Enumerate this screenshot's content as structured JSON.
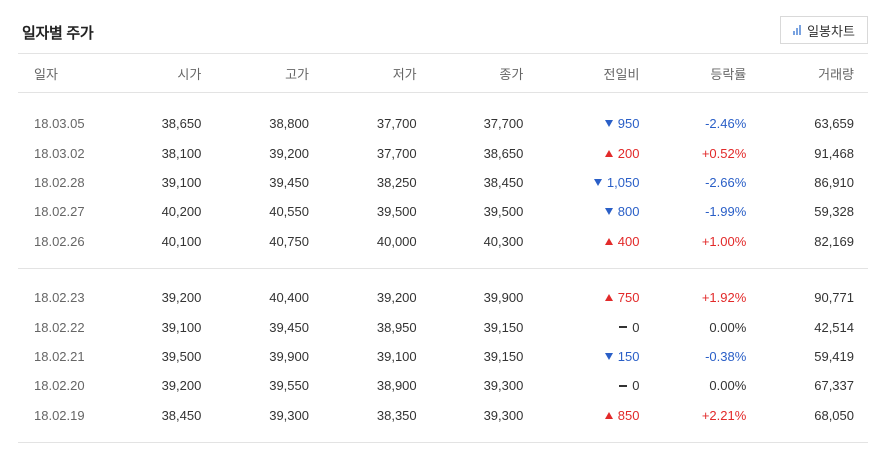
{
  "header": {
    "title": "일자별 주가",
    "chart_button_label": "일봉차트",
    "chart_button_icon": "bar-chart-icon"
  },
  "columns": [
    "일자",
    "시가",
    "고가",
    "저가",
    "종가",
    "전일비",
    "등락률",
    "거래량"
  ],
  "colors": {
    "up": "#e22a2a",
    "down": "#2a5fc7"
  },
  "groups": [
    [
      {
        "date": "18.03.05",
        "open": "38,650",
        "high": "38,800",
        "low": "37,700",
        "close": "37,700",
        "dir": "down",
        "change": "950",
        "rate": "-2.46%",
        "volume": "63,659"
      },
      {
        "date": "18.03.02",
        "open": "38,100",
        "high": "39,200",
        "low": "37,700",
        "close": "38,650",
        "dir": "up",
        "change": "200",
        "rate": "+0.52%",
        "volume": "91,468"
      },
      {
        "date": "18.02.28",
        "open": "39,100",
        "high": "39,450",
        "low": "38,250",
        "close": "38,450",
        "dir": "down",
        "change": "1,050",
        "rate": "-2.66%",
        "volume": "86,910"
      },
      {
        "date": "18.02.27",
        "open": "40,200",
        "high": "40,550",
        "low": "39,500",
        "close": "39,500",
        "dir": "down",
        "change": "800",
        "rate": "-1.99%",
        "volume": "59,328"
      },
      {
        "date": "18.02.26",
        "open": "40,100",
        "high": "40,750",
        "low": "40,000",
        "close": "40,300",
        "dir": "up",
        "change": "400",
        "rate": "+1.00%",
        "volume": "82,169"
      }
    ],
    [
      {
        "date": "18.02.23",
        "open": "39,200",
        "high": "40,400",
        "low": "39,200",
        "close": "39,900",
        "dir": "up",
        "change": "750",
        "rate": "+1.92%",
        "volume": "90,771"
      },
      {
        "date": "18.02.22",
        "open": "39,100",
        "high": "39,450",
        "low": "38,950",
        "close": "39,150",
        "dir": "flat",
        "change": "0",
        "rate": "0.00%",
        "volume": "42,514"
      },
      {
        "date": "18.02.21",
        "open": "39,500",
        "high": "39,900",
        "low": "39,100",
        "close": "39,150",
        "dir": "down",
        "change": "150",
        "rate": "-0.38%",
        "volume": "59,419"
      },
      {
        "date": "18.02.20",
        "open": "39,200",
        "high": "39,550",
        "low": "38,900",
        "close": "39,300",
        "dir": "flat",
        "change": "0",
        "rate": "0.00%",
        "volume": "67,337"
      },
      {
        "date": "18.02.19",
        "open": "38,450",
        "high": "39,300",
        "low": "38,350",
        "close": "39,300",
        "dir": "up",
        "change": "850",
        "rate": "+2.21%",
        "volume": "68,050"
      }
    ]
  ]
}
